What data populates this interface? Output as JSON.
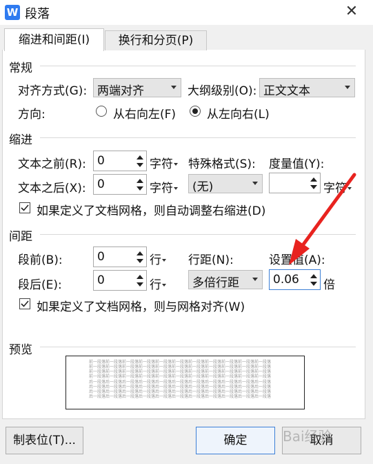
{
  "window": {
    "title": "段落",
    "app_icon_letter": "W",
    "close_glyph": "✕"
  },
  "tabs": [
    {
      "label": "缩进和间距(I)",
      "active": true
    },
    {
      "label": "换行和分页(P)",
      "active": false
    }
  ],
  "general": {
    "heading": "常规",
    "alignment_label": "对齐方式(G):",
    "alignment_value": "两端对齐",
    "outline_label": "大纲级别(O):",
    "outline_value": "正文文本",
    "direction_label": "方向:",
    "rtl_label": "从右向左(F)",
    "ltr_label": "从左向右(L)",
    "selected_direction": "ltr"
  },
  "indent": {
    "heading": "缩进",
    "before_label": "文本之前(R):",
    "before_value": "0",
    "before_unit": "字符",
    "after_label": "文本之后(X):",
    "after_value": "0",
    "after_unit": "字符",
    "special_label": "特殊格式(S):",
    "special_value": "(无)",
    "measure_label": "度量值(Y):",
    "measure_value": "",
    "measure_unit": "字符",
    "grid_check_label": "如果定义了文档网格，则自动调整右缩进(D)",
    "grid_checked": true
  },
  "spacing": {
    "heading": "间距",
    "before_label": "段前(B):",
    "before_value": "0",
    "before_unit": "行",
    "after_label": "段后(E):",
    "after_value": "0",
    "after_unit": "行",
    "line_spacing_label": "行距(N):",
    "line_spacing_value": "多倍行距",
    "setting_label": "设置值(A):",
    "setting_value": "0.06",
    "setting_unit": "倍",
    "grid_check_label": "如果定义了文档网格，则与网格对齐(W)",
    "grid_checked": true
  },
  "preview": {
    "heading": "预览",
    "line_before": "前一段落前一段落前一段落前一段落前一段落前一段落前一段落前一段落前一段落前一段落前一段落",
    "line_after": "后一段落后一段落后一段落后一段落后一段落后一段落后一段落后一段落后一段落后一段落后一段落"
  },
  "buttons": {
    "tabs": "制表位(T)...",
    "ok": "确定",
    "cancel": "取消"
  },
  "watermark": "Bai经验",
  "colors": {
    "accent": "#3c7fd6",
    "arrow": "#e8231f",
    "app_icon": "#2f7bf0"
  }
}
